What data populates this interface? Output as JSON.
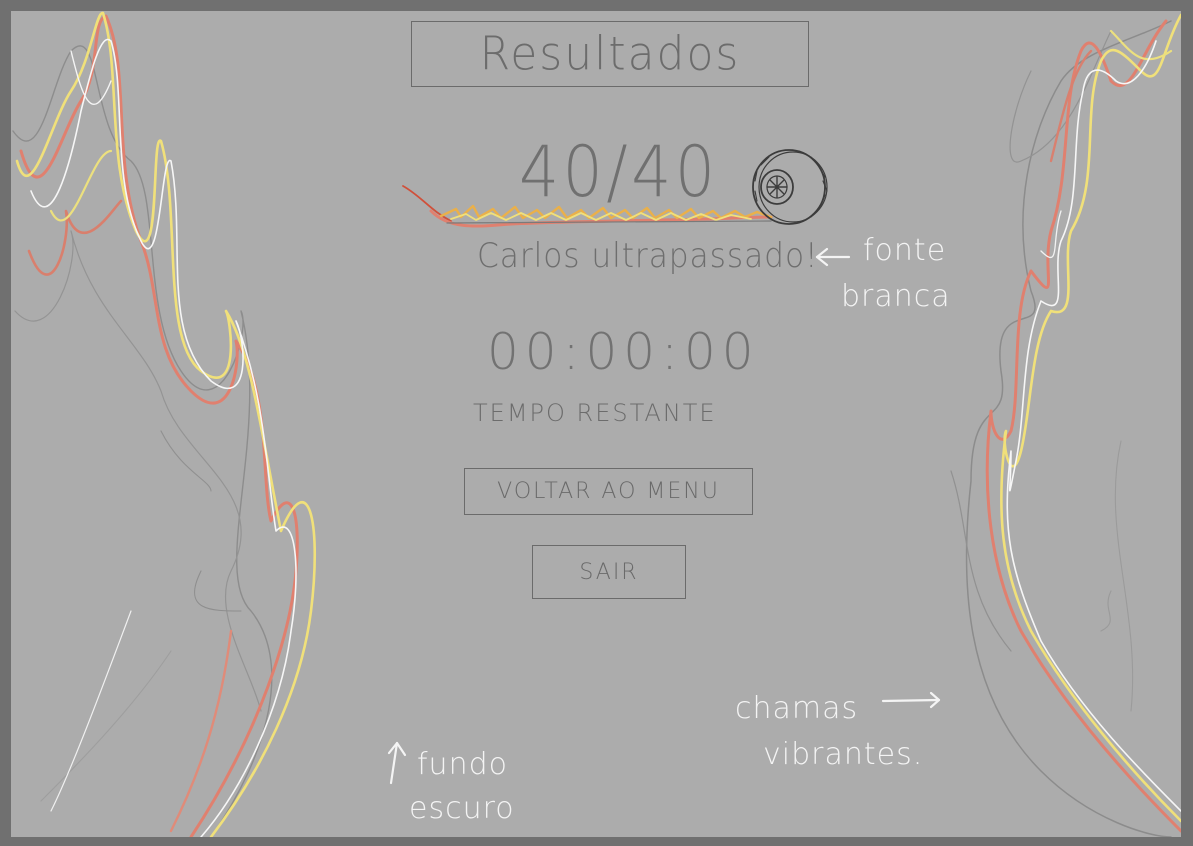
{
  "title": "Resultados",
  "score": "40/40",
  "player_message": "Carlos ultrapassado!",
  "timer": {
    "value": "00:00:00",
    "label": "TEMPO RESTANTE"
  },
  "buttons": {
    "menu": "VOLTAR AO MENU",
    "exit": "SAIR"
  },
  "annotations": {
    "font_note_line1": "fonte",
    "font_note_line2": "branca",
    "flames_note_line1": "chamas",
    "flames_note_line2": "vibrantes.",
    "background_note_line1": "fundo",
    "background_note_line2": "escuro"
  },
  "icons": [
    "tire-icon",
    "fire-trail-icon",
    "flames-left",
    "flames-right",
    "arrow-left-icon",
    "arrow-right-icon",
    "arrow-up-icon"
  ],
  "colors": {
    "background": "#acacac",
    "frame": "#707070",
    "sketch_text": "#6c6c6c",
    "annotation_text": "#f4f4f4",
    "flame_red": "#e0806f",
    "flame_yellow": "#f0e07a",
    "flame_white": "#f6f6f6"
  }
}
